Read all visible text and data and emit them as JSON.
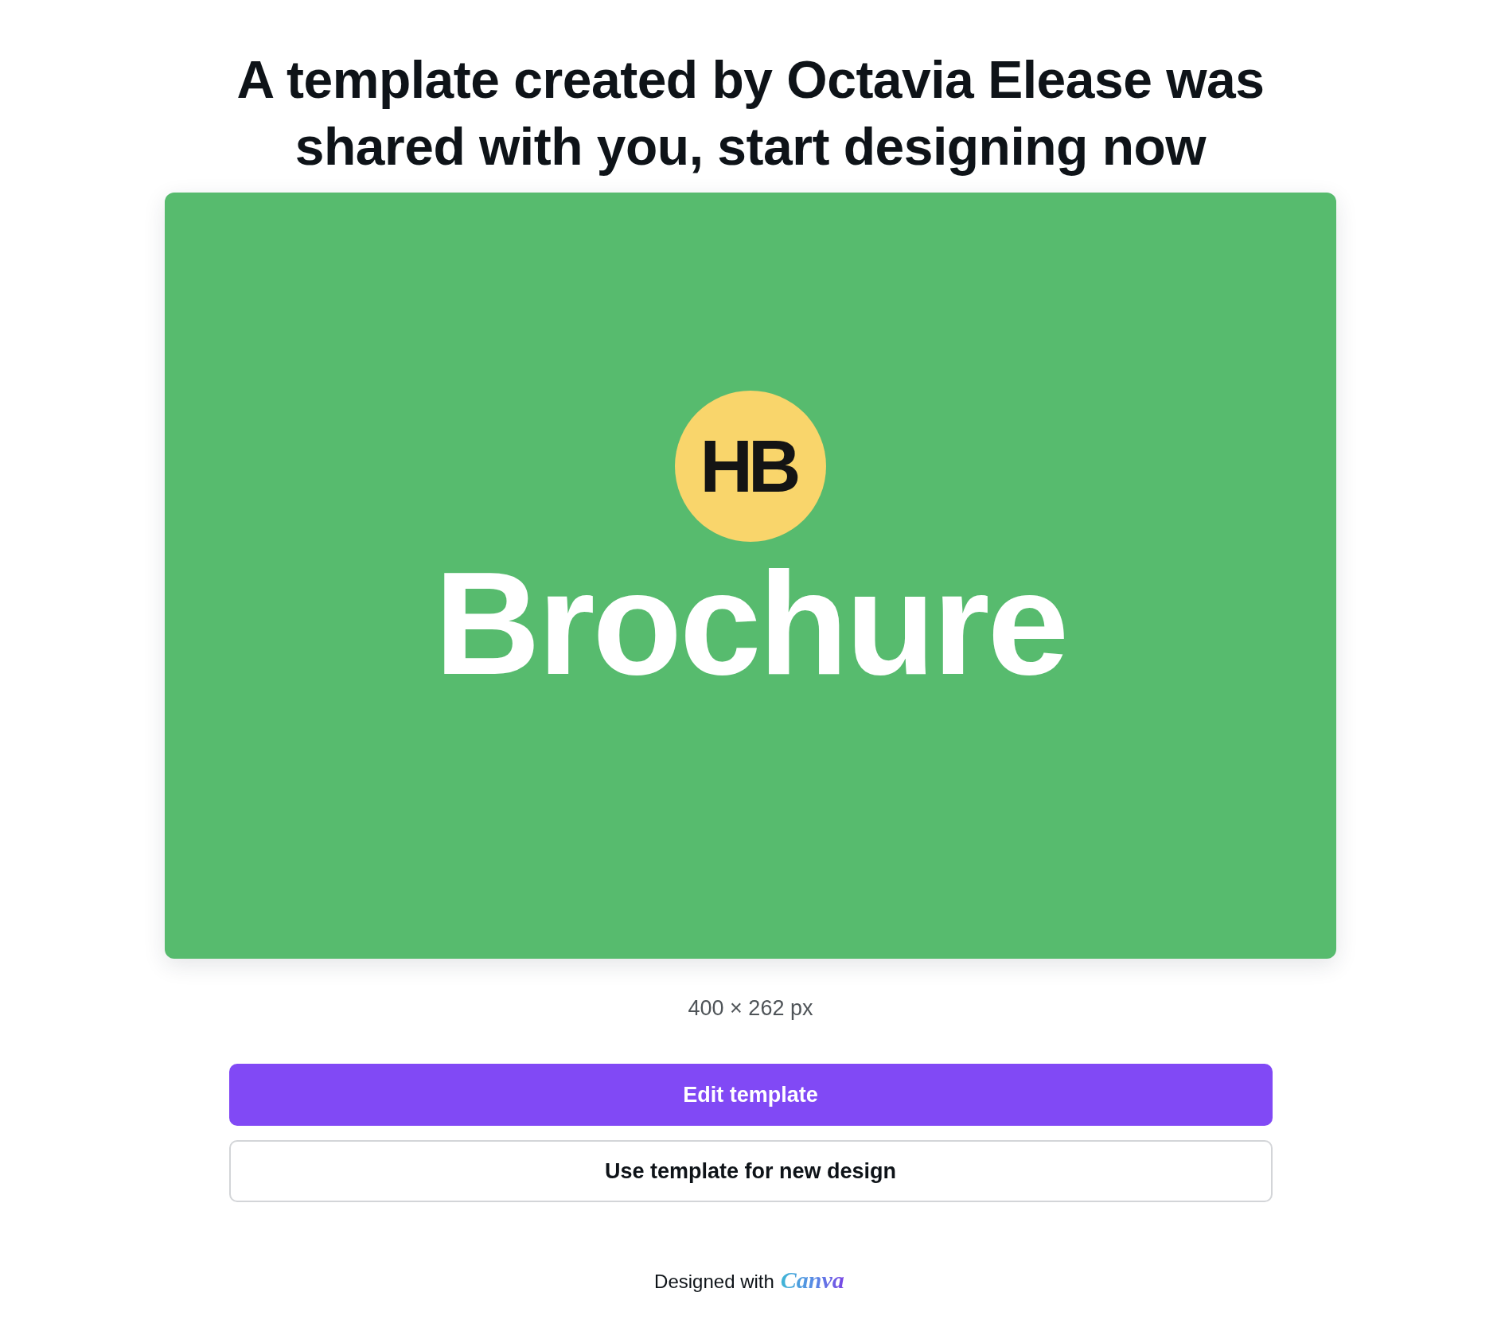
{
  "heading": "A template created by Octavia Elease was shared with you, start designing now",
  "preview": {
    "logo_text": "HB",
    "title": "Brochure"
  },
  "dimensions": "400 × 262 px",
  "buttons": [
    {
      "label": "Edit template",
      "kind": "primary"
    },
    {
      "label": "Use template for new design",
      "kind": "secondary"
    }
  ],
  "footer": {
    "text": "Designed with",
    "brand": "Canva"
  }
}
